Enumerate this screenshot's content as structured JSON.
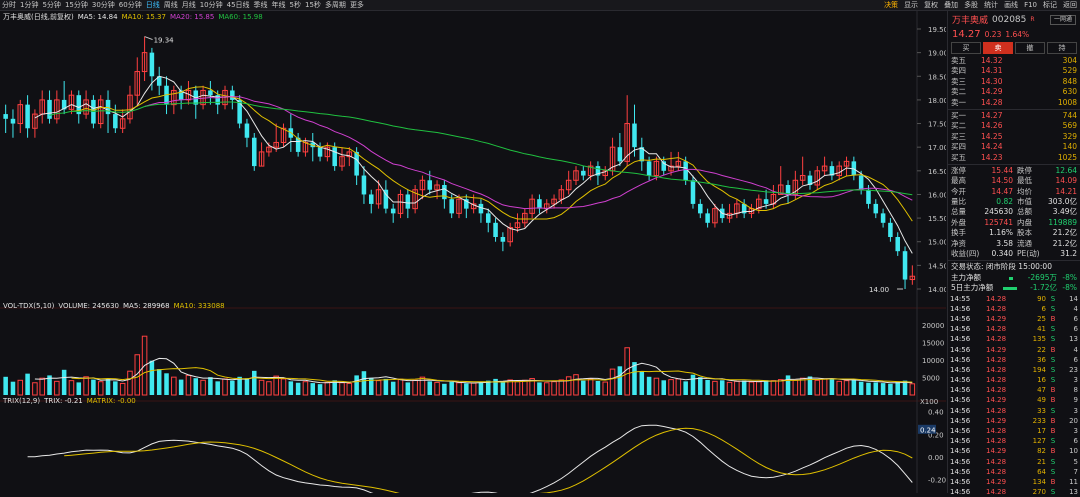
{
  "topbar": {
    "periods": [
      "分时",
      "1分钟",
      "5分钟",
      "15分钟",
      "30分钟",
      "60分钟",
      "日线",
      "周线",
      "月线",
      "10分钟",
      "45日线",
      "季线",
      "年线",
      "5秒",
      "15秒",
      "多周期",
      "更多"
    ],
    "active_period": "日线",
    "right_items": [
      "决策",
      "显示",
      "复权",
      "叠加",
      "多股",
      "统计",
      "画线",
      "F10",
      "标记",
      "返回"
    ]
  },
  "main_legend": {
    "title": "万丰奥威(日线,前复权)",
    "ma5": "MA5: 14.84",
    "ma10": "MA10: 15.37",
    "ma20": "MA20: 15.85",
    "ma60": "MA60: 15.98"
  },
  "annotations": {
    "high": "19.34",
    "low": "14.00"
  },
  "price_axis": [
    "19.50",
    "19.00",
    "18.50",
    "18.00",
    "17.50",
    "17.00",
    "16.50",
    "16.00",
    "15.50",
    "15.00",
    "14.50",
    "14.00"
  ],
  "vol_legend": {
    "title": "VOL-TDX(5,10)",
    "volume": "VOLUME: 245630",
    "ma5": "MA5: 289968",
    "ma10": "MA10: 333088"
  },
  "vol_axis": [
    "20000",
    "15000",
    "10000",
    "5000"
  ],
  "vol_unit": "X100",
  "trix_legend": {
    "title": "TRIX(12,9)",
    "trix": "TRIX: -0.21",
    "matrix": "MATRIX: -0.00"
  },
  "trix_axis": [
    "0.40",
    "0.20",
    "0.00",
    "-0.20"
  ],
  "trix_marker": "0.24",
  "colors": {
    "up": "#ff4040",
    "down": "#40e8f0",
    "ma5": "#e8e8e8",
    "ma10": "#e0c000",
    "ma20": "#d040d0",
    "ma60": "#20c040"
  },
  "stock": {
    "name": "万丰奥威",
    "code": "002085",
    "flag": "R",
    "btn": "一网通",
    "price": "14.27",
    "change": "0.23",
    "pct": "1.64%"
  },
  "tabs": [
    "买",
    "卖",
    "撤",
    "持"
  ],
  "asks": [
    {
      "label": "卖五",
      "price": "14.32",
      "vol": "304"
    },
    {
      "label": "卖四",
      "price": "14.31",
      "vol": "529"
    },
    {
      "label": "卖三",
      "price": "14.30",
      "vol": "848"
    },
    {
      "label": "卖二",
      "price": "14.29",
      "vol": "630"
    },
    {
      "label": "卖一",
      "price": "14.28",
      "vol": "1008"
    }
  ],
  "bids": [
    {
      "label": "买一",
      "price": "14.27",
      "vol": "744"
    },
    {
      "label": "买二",
      "price": "14.26",
      "vol": "569"
    },
    {
      "label": "买三",
      "price": "14.25",
      "vol": "329"
    },
    {
      "label": "买四",
      "price": "14.24",
      "vol": "140"
    },
    {
      "label": "买五",
      "price": "14.23",
      "vol": "1025"
    }
  ],
  "quote": [
    {
      "k": "涨停",
      "v": "15.44",
      "vc": "red",
      "k2": "跌停",
      "v2": "12.64",
      "v2c": "green"
    },
    {
      "k": "最高",
      "v": "14.50",
      "vc": "red",
      "k2": "最低",
      "v2": "14.09",
      "v2c": "red"
    },
    {
      "k": "今开",
      "v": "14.47",
      "vc": "red",
      "k2": "均价",
      "v2": "14.21",
      "v2c": "red"
    },
    {
      "k": "量比",
      "v": "0.82",
      "vc": "green",
      "k2": "市值",
      "v2": "303.0亿",
      "v2c": "wht"
    },
    {
      "k": "总量",
      "v": "245630",
      "vc": "wht",
      "k2": "总额",
      "v2": "3.49亿",
      "v2c": "wht"
    },
    {
      "k": "外盘",
      "v": "125741",
      "vc": "red",
      "k2": "内盘",
      "v2": "119889",
      "v2c": "green"
    },
    {
      "k": "换手",
      "v": "1.16%",
      "vc": "wht",
      "k2": "股本",
      "v2": "21.2亿",
      "v2c": "wht"
    },
    {
      "k": "净资",
      "v": "3.58",
      "vc": "wht",
      "k2": "流通",
      "v2": "21.2亿",
      "v2c": "wht"
    },
    {
      "k": "收益(四)",
      "v": "0.340",
      "vc": "wht",
      "k2": "PE(动)",
      "v2": "31.2",
      "v2c": "wht"
    }
  ],
  "trade_status": "交易状态: 闭市阶段 15:00:00",
  "flows": [
    {
      "label": "主力净额",
      "value": "-2695万",
      "pct": "-8%"
    },
    {
      "label": "5日主力净额",
      "value": "-1.72亿",
      "pct": "-8%"
    }
  ],
  "trades": [
    {
      "t": "14:55",
      "p": "14.28",
      "v": "90",
      "bs": "S",
      "n": "14"
    },
    {
      "t": "14:56",
      "p": "14.28",
      "v": "6",
      "bs": "S",
      "n": "4"
    },
    {
      "t": "14:56",
      "p": "14.29",
      "v": "25",
      "bs": "B",
      "n": "6"
    },
    {
      "t": "14:56",
      "p": "14.28",
      "v": "41",
      "bs": "S",
      "n": "6"
    },
    {
      "t": "14:56",
      "p": "14.28",
      "v": "135",
      "bs": "S",
      "n": "13"
    },
    {
      "t": "14:56",
      "p": "14.29",
      "v": "22",
      "bs": "B",
      "n": "4"
    },
    {
      "t": "14:56",
      "p": "14.28",
      "v": "36",
      "bs": "S",
      "n": "6"
    },
    {
      "t": "14:56",
      "p": "14.28",
      "v": "194",
      "bs": "S",
      "n": "23"
    },
    {
      "t": "14:56",
      "p": "14.28",
      "v": "16",
      "bs": "S",
      "n": "3"
    },
    {
      "t": "14:56",
      "p": "14.28",
      "v": "47",
      "bs": "B",
      "n": "8"
    },
    {
      "t": "14:56",
      "p": "14.29",
      "v": "49",
      "bs": "B",
      "n": "9"
    },
    {
      "t": "14:56",
      "p": "14.28",
      "v": "33",
      "bs": "S",
      "n": "3"
    },
    {
      "t": "14:56",
      "p": "14.29",
      "v": "233",
      "bs": "B",
      "n": "20"
    },
    {
      "t": "14:56",
      "p": "14.28",
      "v": "17",
      "bs": "B",
      "n": "3"
    },
    {
      "t": "14:56",
      "p": "14.28",
      "v": "127",
      "bs": "S",
      "n": "6"
    },
    {
      "t": "14:56",
      "p": "14.29",
      "v": "82",
      "bs": "B",
      "n": "10"
    },
    {
      "t": "14:56",
      "p": "14.28",
      "v": "21",
      "bs": "S",
      "n": "5"
    },
    {
      "t": "14:56",
      "p": "14.28",
      "v": "64",
      "bs": "S",
      "n": "7"
    },
    {
      "t": "14:56",
      "p": "14.29",
      "v": "134",
      "bs": "B",
      "n": "11"
    },
    {
      "t": "14:56",
      "p": "14.28",
      "v": "270",
      "bs": "S",
      "n": "13"
    }
  ],
  "chart_data": {
    "type": "candlestick",
    "price_range": [
      14.0,
      19.5
    ],
    "candles": [
      [
        17.7,
        17.6,
        17.9,
        17.3
      ],
      [
        17.6,
        17.5,
        17.8,
        17.2
      ],
      [
        17.5,
        17.9,
        18.0,
        17.3
      ],
      [
        17.9,
        17.4,
        18.1,
        17.2
      ],
      [
        17.4,
        17.7,
        17.8,
        17.2
      ],
      [
        17.7,
        18.0,
        18.2,
        17.5
      ],
      [
        18.0,
        17.6,
        18.2,
        17.5
      ],
      [
        17.6,
        18.0,
        18.2,
        17.5
      ],
      [
        18.0,
        17.8,
        18.4,
        17.7
      ],
      [
        17.8,
        18.1,
        18.2,
        17.7
      ],
      [
        18.1,
        17.7,
        18.2,
        17.5
      ],
      [
        17.7,
        18.0,
        18.2,
        17.6
      ],
      [
        18.0,
        17.5,
        18.1,
        17.4
      ],
      [
        17.5,
        18.0,
        18.1,
        17.4
      ],
      [
        18.0,
        17.7,
        18.2,
        17.3
      ],
      [
        17.7,
        17.4,
        17.9,
        17.3
      ],
      [
        17.4,
        17.6,
        17.8,
        17.3
      ],
      [
        17.6,
        18.1,
        18.3,
        17.5
      ],
      [
        18.1,
        18.6,
        18.9,
        17.9
      ],
      [
        18.6,
        19.0,
        19.34,
        18.4
      ],
      [
        19.0,
        18.5,
        19.1,
        18.2
      ],
      [
        18.5,
        18.3,
        18.7,
        18.1
      ],
      [
        18.3,
        17.9,
        18.5,
        17.7
      ],
      [
        17.9,
        18.2,
        18.3,
        17.7
      ],
      [
        18.2,
        18.0,
        18.3,
        17.8
      ],
      [
        18.0,
        18.2,
        18.4,
        17.9
      ],
      [
        18.2,
        17.9,
        18.3,
        17.6
      ],
      [
        17.9,
        18.2,
        18.3,
        17.8
      ],
      [
        18.2,
        18.1,
        18.4,
        17.9
      ],
      [
        18.1,
        17.9,
        18.2,
        17.7
      ],
      [
        17.9,
        18.2,
        18.3,
        17.8
      ],
      [
        18.2,
        18.0,
        18.3,
        17.8
      ],
      [
        18.0,
        17.5,
        18.1,
        17.4
      ],
      [
        17.5,
        17.2,
        17.6,
        17.0
      ],
      [
        17.2,
        16.6,
        17.3,
        16.5
      ],
      [
        16.6,
        16.9,
        17.1,
        16.6
      ],
      [
        16.9,
        17.0,
        17.1,
        16.8
      ],
      [
        17.0,
        17.1,
        17.5,
        16.9
      ],
      [
        17.1,
        17.4,
        17.5,
        17.0
      ],
      [
        17.4,
        17.2,
        17.7,
        16.9
      ],
      [
        17.2,
        16.9,
        17.3,
        16.8
      ],
      [
        16.9,
        17.1,
        17.2,
        16.8
      ],
      [
        17.1,
        17.0,
        17.3,
        16.7
      ],
      [
        17.0,
        16.8,
        17.1,
        16.7
      ],
      [
        16.8,
        17.0,
        17.1,
        16.7
      ],
      [
        17.0,
        16.6,
        17.1,
        16.5
      ],
      [
        16.6,
        16.8,
        17.0,
        16.5
      ],
      [
        16.8,
        16.9,
        17.0,
        16.6
      ],
      [
        16.9,
        16.4,
        17.0,
        16.2
      ],
      [
        16.4,
        16.0,
        16.6,
        15.8
      ],
      [
        16.0,
        15.8,
        16.1,
        15.6
      ],
      [
        15.8,
        16.1,
        16.3,
        15.7
      ],
      [
        16.1,
        15.7,
        16.3,
        15.6
      ],
      [
        15.7,
        15.6,
        15.8,
        15.4
      ],
      [
        15.6,
        16.0,
        16.1,
        15.5
      ],
      [
        16.0,
        15.7,
        16.1,
        15.5
      ],
      [
        15.7,
        16.1,
        16.2,
        15.6
      ],
      [
        16.1,
        16.3,
        16.4,
        15.9
      ],
      [
        16.3,
        16.1,
        16.5,
        16.0
      ],
      [
        16.1,
        16.2,
        16.3,
        15.9
      ],
      [
        16.2,
        15.9,
        16.3,
        15.7
      ],
      [
        15.9,
        15.6,
        16.0,
        15.5
      ],
      [
        15.6,
        15.9,
        16.0,
        15.5
      ],
      [
        15.9,
        15.7,
        16.0,
        15.5
      ],
      [
        15.7,
        15.8,
        16.0,
        15.6
      ],
      [
        15.8,
        15.6,
        15.9,
        15.4
      ],
      [
        15.6,
        15.4,
        15.7,
        15.2
      ],
      [
        15.4,
        15.1,
        15.5,
        15.0
      ],
      [
        15.1,
        15.0,
        15.2,
        14.8
      ],
      [
        15.0,
        15.3,
        15.4,
        14.9
      ],
      [
        15.3,
        15.4,
        15.6,
        15.2
      ],
      [
        15.4,
        15.6,
        15.7,
        15.3
      ],
      [
        15.6,
        15.9,
        16.0,
        15.5
      ],
      [
        15.9,
        15.7,
        16.0,
        15.6
      ],
      [
        15.7,
        15.8,
        15.9,
        15.6
      ],
      [
        15.8,
        15.9,
        16.0,
        15.7
      ],
      [
        15.9,
        16.1,
        16.2,
        15.8
      ],
      [
        16.1,
        16.3,
        16.5,
        16.0
      ],
      [
        16.3,
        16.5,
        16.6,
        16.2
      ],
      [
        16.5,
        16.4,
        16.6,
        16.3
      ],
      [
        16.4,
        16.6,
        16.7,
        16.3
      ],
      [
        16.6,
        16.4,
        16.7,
        16.2
      ],
      [
        16.4,
        16.5,
        16.6,
        16.3
      ],
      [
        16.5,
        17.0,
        17.2,
        16.4
      ],
      [
        17.0,
        16.7,
        17.3,
        16.6
      ],
      [
        16.7,
        17.5,
        18.1,
        16.6
      ],
      [
        17.5,
        17.0,
        17.9,
        16.8
      ],
      [
        17.0,
        16.7,
        17.2,
        16.5
      ],
      [
        16.7,
        16.4,
        16.8,
        16.3
      ],
      [
        16.4,
        16.7,
        16.8,
        16.3
      ],
      [
        16.7,
        16.5,
        16.8,
        16.4
      ],
      [
        16.5,
        16.6,
        16.9,
        16.4
      ],
      [
        16.6,
        16.7,
        16.9,
        16.5
      ],
      [
        16.7,
        16.3,
        16.8,
        16.2
      ],
      [
        16.3,
        15.8,
        16.4,
        15.7
      ],
      [
        15.8,
        15.6,
        15.9,
        15.5
      ],
      [
        15.6,
        15.4,
        15.7,
        15.3
      ],
      [
        15.4,
        15.7,
        15.8,
        15.3
      ],
      [
        15.7,
        15.5,
        15.8,
        15.4
      ],
      [
        15.5,
        15.6,
        15.8,
        15.4
      ],
      [
        15.6,
        15.8,
        15.9,
        15.5
      ],
      [
        15.8,
        15.6,
        15.9,
        15.5
      ],
      [
        15.6,
        15.7,
        15.8,
        15.5
      ],
      [
        15.7,
        15.9,
        16.0,
        15.6
      ],
      [
        15.9,
        15.8,
        16.1,
        15.7
      ],
      [
        15.8,
        16.0,
        16.2,
        15.7
      ],
      [
        16.0,
        16.2,
        16.6,
        16.0
      ],
      [
        16.2,
        16.0,
        16.3,
        15.8
      ],
      [
        16.0,
        16.3,
        16.5,
        15.9
      ],
      [
        16.3,
        16.4,
        16.8,
        16.2
      ],
      [
        16.4,
        16.2,
        16.5,
        16.1
      ],
      [
        16.2,
        16.5,
        16.6,
        16.1
      ],
      [
        16.5,
        16.6,
        16.8,
        16.4
      ],
      [
        16.6,
        16.4,
        16.7,
        16.3
      ],
      [
        16.4,
        16.6,
        16.7,
        16.3
      ],
      [
        16.6,
        16.7,
        16.8,
        16.4
      ],
      [
        16.7,
        16.4,
        16.8,
        16.3
      ],
      [
        16.4,
        16.1,
        16.5,
        16.0
      ],
      [
        16.1,
        15.8,
        16.2,
        15.7
      ],
      [
        15.8,
        15.6,
        15.9,
        15.5
      ],
      [
        15.6,
        15.4,
        15.7,
        15.3
      ],
      [
        15.4,
        15.1,
        15.5,
        15.0
      ],
      [
        15.1,
        14.8,
        15.2,
        14.7
      ],
      [
        14.8,
        14.2,
        14.9,
        14.0
      ],
      [
        14.2,
        14.27,
        14.5,
        14.09
      ]
    ],
    "volume_range": [
      0,
      24000
    ],
    "volumes": [
      5200,
      3800,
      4200,
      6100,
      3500,
      4800,
      5600,
      3900,
      7200,
      4100,
      3600,
      5200,
      4400,
      3800,
      4600,
      3900,
      3300,
      6800,
      11500,
      16800,
      9800,
      7400,
      6200,
      5100,
      4400,
      5600,
      4800,
      4200,
      5100,
      3900,
      4600,
      4100,
      5200,
      4800,
      6900,
      4200,
      3800,
      5400,
      4600,
      3900,
      3500,
      3800,
      3400,
      3100,
      3600,
      4200,
      3500,
      3300,
      5600,
      6800,
      4900,
      4100,
      4600,
      3800,
      4500,
      3600,
      4200,
      5100,
      3900,
      3600,
      3200,
      3800,
      3500,
      3300,
      3400,
      3700,
      4100,
      4600,
      3900,
      4300,
      3800,
      4200,
      4700,
      3600,
      3500,
      3800,
      4300,
      5200,
      5800,
      4100,
      4600,
      4000,
      3700,
      7400,
      8200,
      13500,
      9400,
      6800,
      5200,
      4800,
      4200,
      4400,
      4600,
      3900,
      5800,
      5100,
      4300,
      3900,
      4200,
      3600,
      3900,
      4100,
      3700,
      3800,
      4200,
      4100,
      4400,
      5600,
      4200,
      4800,
      5300,
      4200,
      4600,
      4700,
      3900,
      4100,
      4300,
      3800,
      3500,
      3600,
      3400,
      3200,
      3700,
      4100,
      3200
    ],
    "trix_range": [
      -0.3,
      0.45
    ]
  }
}
